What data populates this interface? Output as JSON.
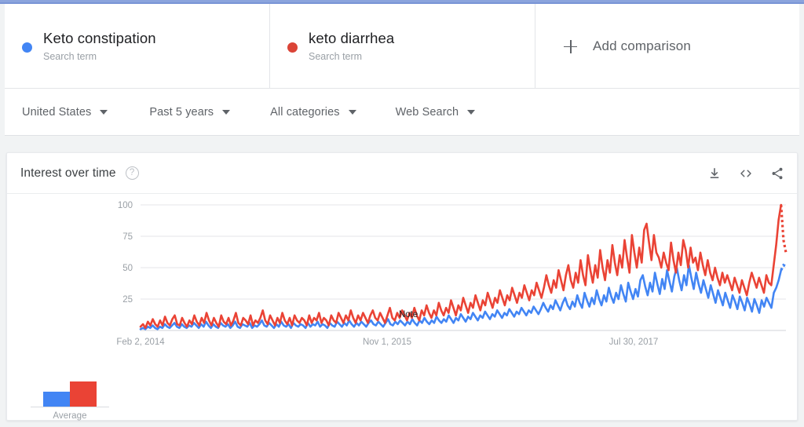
{
  "header": {
    "terms": [
      {
        "title": "Keto constipation",
        "subtitle": "Search term",
        "color": "#4285f4",
        "dot_name": "blue-dot-icon"
      },
      {
        "title": "keto diarrhea",
        "subtitle": "Search term",
        "color": "#db4437",
        "dot_name": "red-dot-icon"
      }
    ],
    "add_comparison_label": "Add comparison",
    "plus_icon": "plus-icon"
  },
  "filters": [
    {
      "label": "United States",
      "name": "filter-location"
    },
    {
      "label": "Past 5 years",
      "name": "filter-time-range"
    },
    {
      "label": "All categories",
      "name": "filter-category"
    },
    {
      "label": "Web Search",
      "name": "filter-search-type"
    }
  ],
  "card": {
    "title": "Interest over time",
    "help_icon": "help-icon",
    "help_glyph": "?",
    "actions": [
      {
        "name": "download-icon",
        "tooltip": "Download"
      },
      {
        "name": "embed-code-icon",
        "tooltip": "Embed"
      },
      {
        "name": "share-icon",
        "tooltip": "Share"
      }
    ]
  },
  "chart_data": {
    "type": "line",
    "title": "Interest over time",
    "xlabel": "",
    "ylabel": "",
    "ylim": [
      0,
      100
    ],
    "yticks": [
      25,
      50,
      75,
      100
    ],
    "grid": true,
    "legend_position": "top",
    "xticks": [
      "Feb 2, 2014",
      "Nov 1, 2015",
      "Jul 30, 2017"
    ],
    "xtick_positions": [
      0.0,
      0.382,
      0.764
    ],
    "annotation": {
      "text": "Note",
      "x_frac": 0.415,
      "y_value": 8
    },
    "partial_data_dashed_tail": true,
    "average_bars": {
      "label": "Average",
      "series": [
        "Keto constipation",
        "keto diarrhea"
      ],
      "values": [
        12,
        20
      ]
    },
    "series": [
      {
        "name": "Keto constipation",
        "color": "#4285f4",
        "values": [
          1,
          2,
          1,
          3,
          2,
          4,
          2,
          1,
          3,
          2,
          5,
          3,
          2,
          4,
          6,
          3,
          2,
          5,
          3,
          2,
          4,
          3,
          6,
          4,
          2,
          5,
          3,
          7,
          4,
          2,
          5,
          3,
          2,
          6,
          4,
          3,
          5,
          2,
          4,
          7,
          3,
          2,
          5,
          4,
          3,
          6,
          2,
          4,
          3,
          5,
          8,
          4,
          3,
          6,
          4,
          2,
          5,
          3,
          7,
          4,
          3,
          5,
          2,
          6,
          4,
          3,
          5,
          4,
          2,
          6,
          3,
          5,
          4,
          7,
          3,
          5,
          4,
          2,
          6,
          4,
          3,
          7,
          5,
          3,
          6,
          4,
          8,
          5,
          3,
          6,
          4,
          7,
          5,
          3,
          6,
          8,
          5,
          4,
          7,
          5,
          3,
          6,
          9,
          5,
          4,
          7,
          5,
          8,
          6,
          4,
          7,
          5,
          9,
          6,
          4,
          8,
          6,
          10,
          7,
          5,
          8,
          6,
          11,
          8,
          6,
          9,
          7,
          12,
          9,
          6,
          10,
          8,
          13,
          10,
          7,
          11,
          9,
          14,
          11,
          8,
          12,
          10,
          15,
          12,
          9,
          13,
          11,
          16,
          13,
          10,
          14,
          12,
          17,
          14,
          11,
          15,
          13,
          18,
          15,
          12,
          16,
          14,
          19,
          16,
          13,
          17,
          22,
          18,
          15,
          20,
          17,
          24,
          20,
          16,
          22,
          26,
          20,
          17,
          23,
          19,
          28,
          22,
          18,
          30,
          24,
          19,
          26,
          21,
          32,
          25,
          20,
          28,
          23,
          34,
          27,
          22,
          30,
          25,
          36,
          29,
          23,
          38,
          31,
          25,
          33,
          27,
          40,
          44,
          35,
          28,
          38,
          31,
          46,
          37,
          29,
          41,
          33,
          48,
          39,
          31,
          43,
          50,
          40,
          32,
          44,
          36,
          52,
          42,
          33,
          46,
          37,
          30,
          40,
          33,
          26,
          36,
          29,
          22,
          32,
          26,
          20,
          30,
          24,
          18,
          28,
          23,
          17,
          27,
          22,
          16,
          26,
          21,
          15,
          25,
          20,
          14,
          24,
          19,
          26,
          22,
          18,
          30,
          34,
          40,
          48,
          52,
          51
        ]
      },
      {
        "name": "keto diarrhea",
        "color": "#ea4335",
        "values": [
          3,
          5,
          2,
          7,
          4,
          9,
          5,
          3,
          8,
          4,
          11,
          6,
          4,
          9,
          12,
          5,
          4,
          10,
          6,
          3,
          8,
          5,
          12,
          7,
          4,
          10,
          6,
          14,
          8,
          4,
          10,
          6,
          3,
          12,
          7,
          5,
          10,
          4,
          8,
          14,
          6,
          4,
          10,
          8,
          5,
          12,
          4,
          8,
          6,
          10,
          16,
          8,
          5,
          12,
          8,
          4,
          10,
          6,
          14,
          8,
          5,
          10,
          4,
          12,
          8,
          6,
          10,
          8,
          4,
          12,
          6,
          10,
          8,
          14,
          6,
          10,
          8,
          4,
          12,
          8,
          6,
          14,
          10,
          6,
          12,
          8,
          16,
          10,
          6,
          12,
          8,
          14,
          10,
          6,
          12,
          16,
          10,
          8,
          14,
          10,
          6,
          12,
          18,
          10,
          8,
          14,
          10,
          16,
          12,
          8,
          14,
          10,
          18,
          12,
          8,
          16,
          12,
          20,
          14,
          10,
          16,
          12,
          22,
          16,
          12,
          18,
          14,
          24,
          18,
          12,
          20,
          16,
          26,
          20,
          14,
          22,
          18,
          28,
          22,
          16,
          24,
          20,
          30,
          24,
          18,
          26,
          22,
          32,
          26,
          20,
          28,
          24,
          34,
          28,
          22,
          30,
          26,
          36,
          30,
          24,
          32,
          28,
          38,
          32,
          26,
          34,
          44,
          36,
          30,
          40,
          34,
          48,
          40,
          32,
          44,
          52,
          40,
          34,
          46,
          38,
          56,
          44,
          36,
          60,
          48,
          38,
          52,
          42,
          64,
          50,
          40,
          56,
          46,
          68,
          54,
          44,
          60,
          50,
          72,
          58,
          46,
          76,
          62,
          50,
          66,
          54,
          80,
          85,
          70,
          56,
          76,
          62,
          58,
          50,
          62,
          54,
          48,
          70,
          56,
          46,
          62,
          52,
          72,
          64,
          50,
          66,
          54,
          58,
          48,
          62,
          52,
          44,
          56,
          46,
          40,
          50,
          42,
          36,
          46,
          38,
          44,
          38,
          32,
          42,
          36,
          30,
          40,
          34,
          28,
          38,
          46,
          40,
          34,
          42,
          36,
          30,
          44,
          38,
          36,
          52,
          68,
          88,
          100,
          72,
          62
        ]
      }
    ]
  }
}
